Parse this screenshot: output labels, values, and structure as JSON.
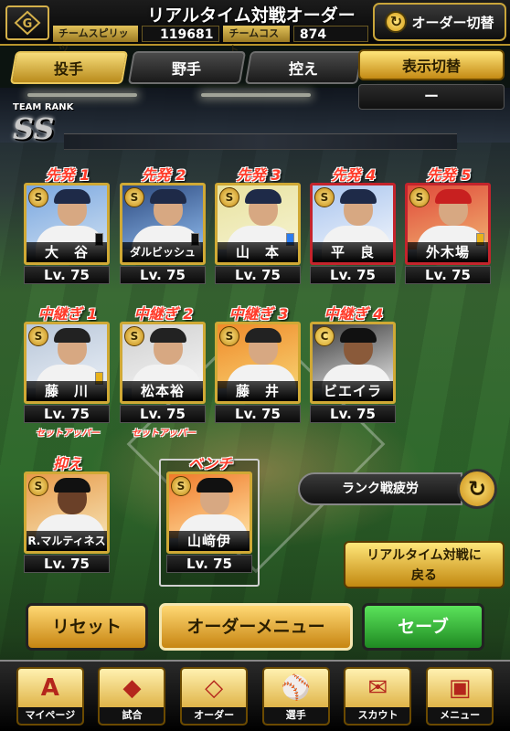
{
  "header": {
    "title": "リアルタイム対戦オーダー",
    "team_spirit_label": "チームスピリッツ",
    "team_spirit_value": "119681",
    "team_cost_label": "チームコスト",
    "team_cost_value": "874",
    "order_toggle_label": "オーダー切替"
  },
  "tabs": [
    {
      "label": "投手",
      "active": true
    },
    {
      "label": "野手",
      "active": false
    },
    {
      "label": "控え",
      "active": false
    }
  ],
  "display_toggle": {
    "label": "表示切替",
    "value": "ー"
  },
  "team_rank": {
    "label": "TEAM RANK",
    "value": "SS"
  },
  "starters": [
    {
      "position": "先発 1",
      "name": "大　谷",
      "level": "Lv. 75"
    },
    {
      "position": "先発 2",
      "name": "ダルビッシュ",
      "level": "Lv. 75"
    },
    {
      "position": "先発 3",
      "name": "山　本",
      "level": "Lv. 75"
    },
    {
      "position": "先発 4",
      "name": "平　良",
      "level": "Lv. 75"
    },
    {
      "position": "先発 5",
      "name": "外木場",
      "level": "Lv. 75"
    }
  ],
  "relievers": [
    {
      "position": "中継ぎ 1",
      "name": "藤　川",
      "level": "Lv. 75",
      "role": "セットアッパー"
    },
    {
      "position": "中継ぎ 2",
      "name": "松本裕",
      "level": "Lv. 75",
      "role": "セットアッパー"
    },
    {
      "position": "中継ぎ 3",
      "name": "藤　井",
      "level": "Lv. 75",
      "role": ""
    },
    {
      "position": "中継ぎ 4",
      "name": "ビエイラ",
      "level": "Lv. 75",
      "role": ""
    }
  ],
  "closer": {
    "position": "抑え",
    "name": "R.マルティネス",
    "level": "Lv. 75"
  },
  "bench": {
    "position": "ベンチ",
    "name": "山﨑伊",
    "level": "Lv. 75"
  },
  "rank_fatigue_label": "ランク戦疲労",
  "return_button": {
    "line1": "リアルタイム対戦に",
    "line2": "戻る"
  },
  "buttons": {
    "reset": "リセット",
    "order_menu": "オーダーメニュー",
    "save": "セーブ"
  },
  "bottom_nav": [
    {
      "label": "マイページ",
      "icon": "A"
    },
    {
      "label": "試合",
      "icon": "◆"
    },
    {
      "label": "オーダー",
      "icon": "◇"
    },
    {
      "label": "選手",
      "icon": "⚾"
    },
    {
      "label": "スカウト",
      "icon": "✉"
    },
    {
      "label": "メニュー",
      "icon": "▣"
    }
  ],
  "colors": {
    "gold": "#d0a935",
    "position_red": "#ff3b2a",
    "save_green": "#1f8a22"
  }
}
